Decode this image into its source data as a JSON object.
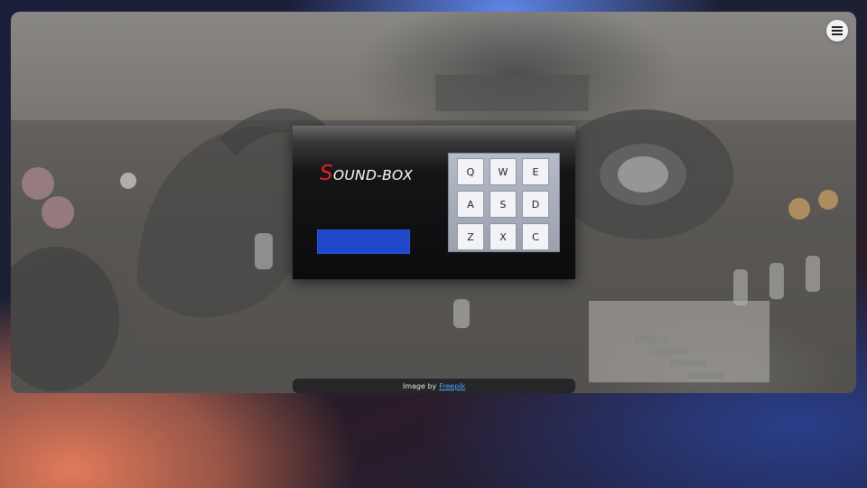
{
  "menu": {
    "icon": "hamburger-menu-icon"
  },
  "soundbox": {
    "title_first": "S",
    "title_rest": "OUND-BOX",
    "display_color": "#1f47c8",
    "pads": [
      "Q",
      "W",
      "E",
      "A",
      "S",
      "D",
      "Z",
      "X",
      "C"
    ]
  },
  "credit": {
    "prefix": "Image by",
    "link_text": "Freepik"
  },
  "colors": {
    "accent_red": "#e0202a",
    "link_blue": "#4aa3ff"
  }
}
